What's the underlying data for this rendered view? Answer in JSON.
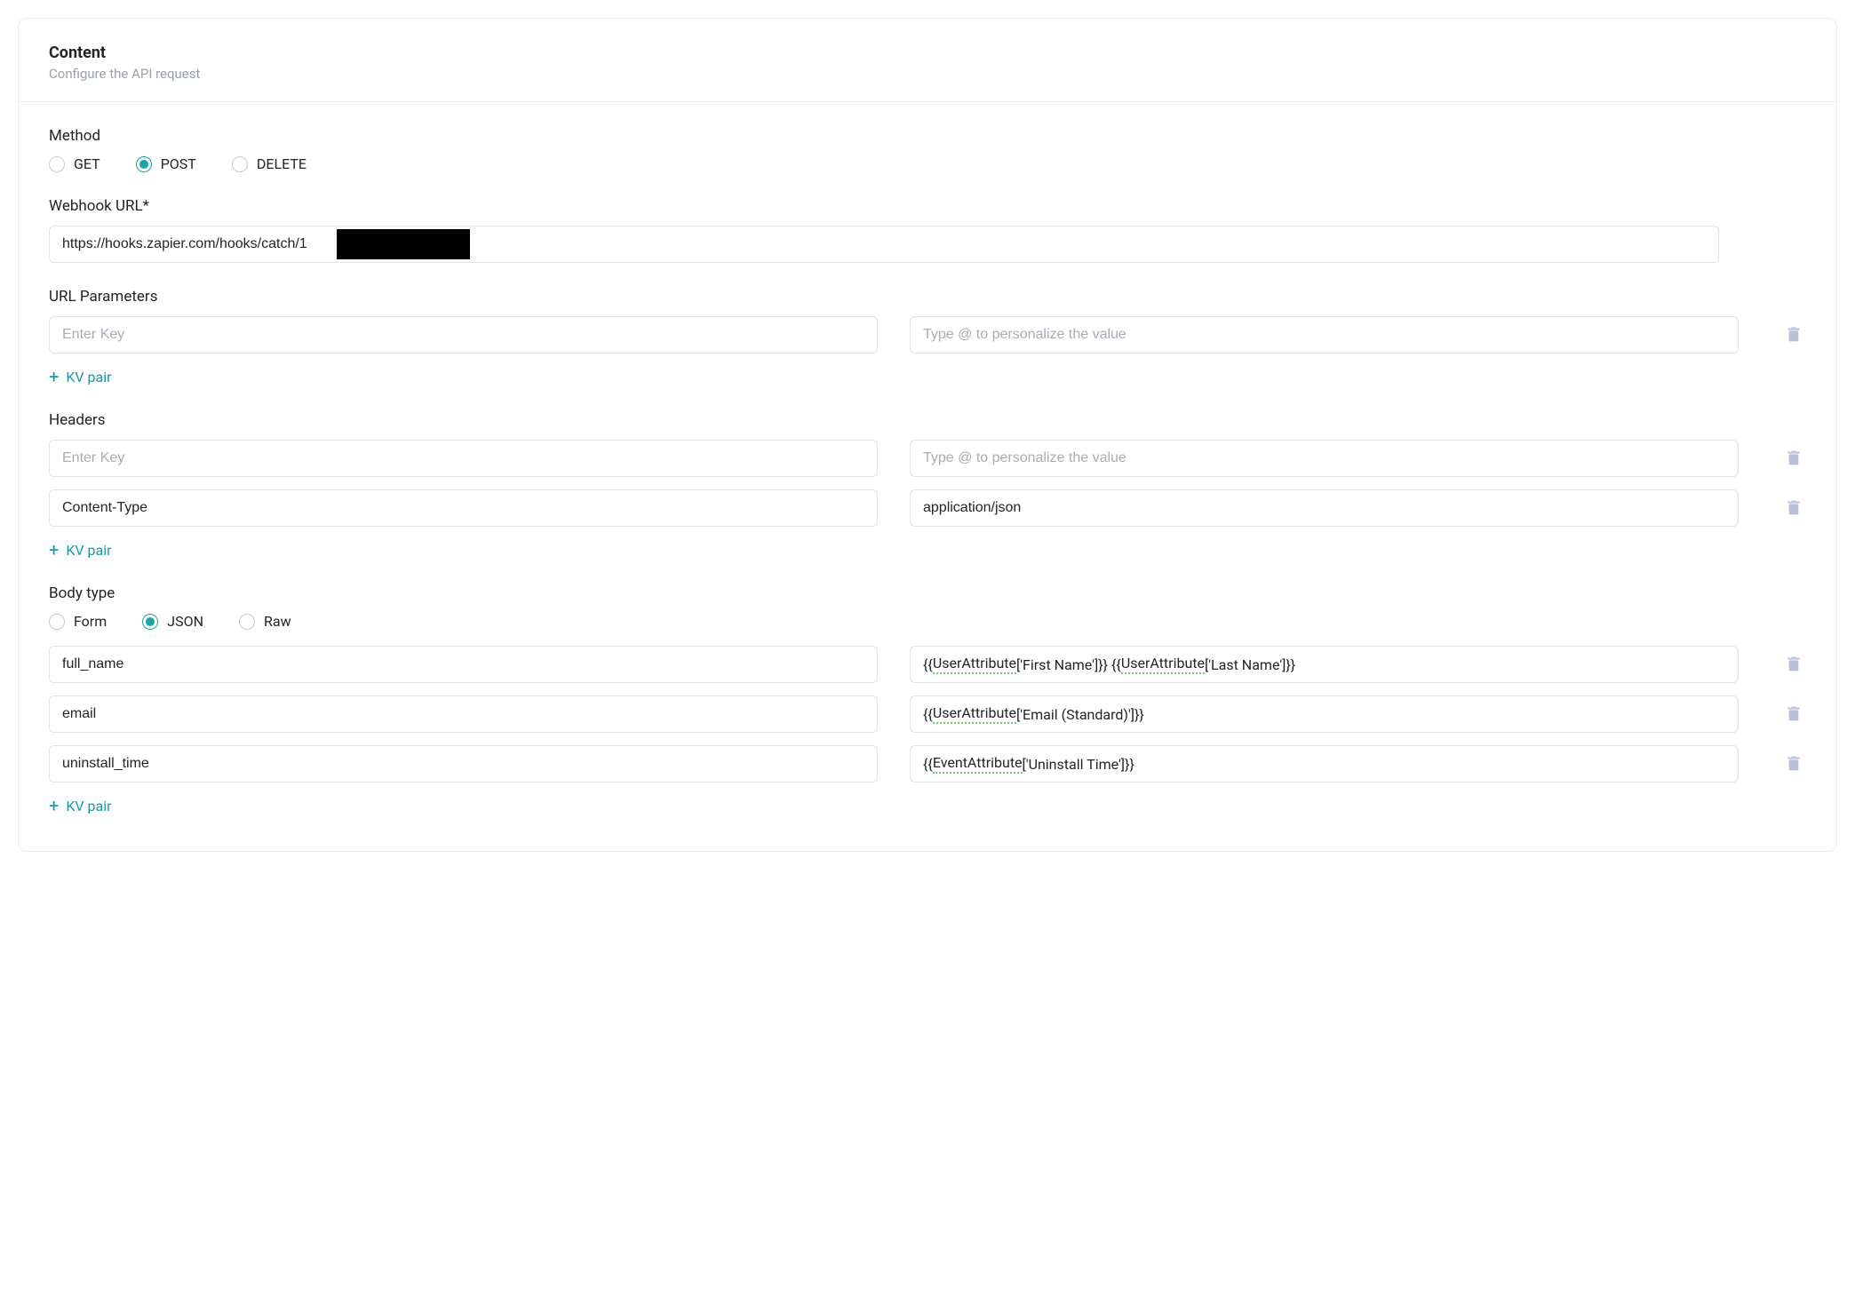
{
  "header": {
    "title": "Content",
    "subtitle": "Configure the API request"
  },
  "method": {
    "label": "Method",
    "options": [
      {
        "id": "get",
        "label": "GET",
        "checked": false
      },
      {
        "id": "post",
        "label": "POST",
        "checked": true
      },
      {
        "id": "delete",
        "label": "DELETE",
        "checked": false
      }
    ]
  },
  "webhook": {
    "label": "Webhook URL*",
    "value": "https://hooks.zapier.com/hooks/catch/1                              /"
  },
  "url_params": {
    "label": "URL Parameters",
    "rows": [
      {
        "key": "",
        "key_placeholder": "Enter Key",
        "value": "",
        "value_placeholder": "Type @ to personalize the value"
      }
    ],
    "add_label": "KV pair"
  },
  "headers": {
    "label": "Headers",
    "rows": [
      {
        "key": "",
        "key_placeholder": "Enter Key",
        "value": "",
        "value_placeholder": "Type @ to personalize the value"
      },
      {
        "key": "Content-Type",
        "key_placeholder": "Enter Key",
        "value": "application/json",
        "value_placeholder": "Type @ to personalize the value"
      }
    ],
    "add_label": "KV pair"
  },
  "body": {
    "label": "Body type",
    "options": [
      {
        "id": "form",
        "label": "Form",
        "checked": false
      },
      {
        "id": "json",
        "label": "JSON",
        "checked": true
      },
      {
        "id": "raw",
        "label": "Raw",
        "checked": false
      }
    ],
    "rows": [
      {
        "key": "full_name",
        "value_plain": "{{UserAttribute['First Name']}} {{UserAttribute['Last Name']}}",
        "value_parts": [
          "{{",
          "UserAttribute",
          "['First Name']}} {{",
          "UserAttribute",
          "['Last Name']}}"
        ],
        "token_indices": [
          1,
          3
        ]
      },
      {
        "key": "email",
        "value_plain": "{{UserAttribute['Email (Standard)']}}",
        "value_parts": [
          "{{",
          "UserAttribute",
          "['Email (Standard)']}}"
        ],
        "token_indices": [
          1
        ]
      },
      {
        "key": "uninstall_time",
        "value_plain": "{{EventAttribute['Uninstall Time']}}",
        "value_parts": [
          "{{",
          "EventAttribute",
          "['Uninstall Time']}}"
        ],
        "token_indices": [
          1
        ]
      }
    ],
    "add_label": "KV pair"
  },
  "icons": {
    "plus": "+"
  }
}
